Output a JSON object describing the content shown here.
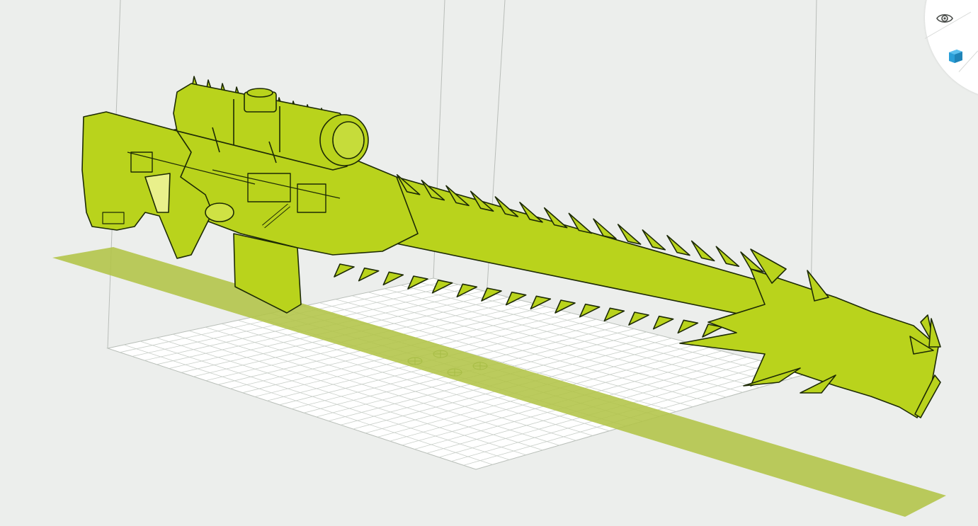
{
  "app": {
    "type": "3d-print-slicer-viewport"
  },
  "scene": {
    "model_color": "#b9d31c",
    "model_outline_color": "#1d2a05",
    "bed_grid_color": "#c9cfc9",
    "bed_color": "#ffffff",
    "background_color": "#eceeec",
    "overhang_plane_color": "#b2c447"
  },
  "view_controls": {
    "items": [
      {
        "icon": "eye-icon",
        "action": "view-visibility"
      },
      {
        "icon": "cube-icon",
        "action": "object-view",
        "accent": "#2a9fd8"
      }
    ]
  }
}
